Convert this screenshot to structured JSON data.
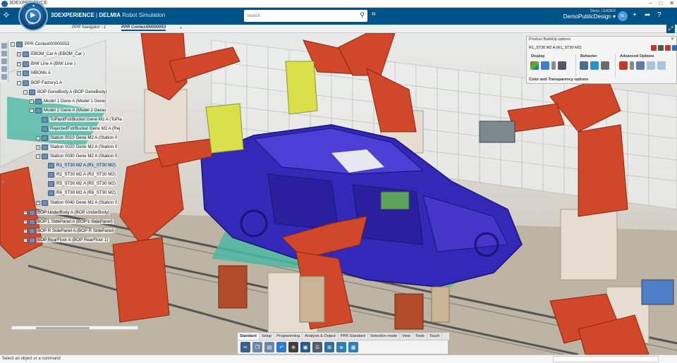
{
  "window": {
    "title": "3DEXPERIENCE",
    "controls": [
      "–",
      "□",
      "✕"
    ]
  },
  "header": {
    "brand_bold": "3DEXPERIENCE",
    "brand_sep": " | ",
    "brand_product": "DELMIA",
    "brand_app": "Robot Simulation",
    "compass_version": "V.R",
    "search_placeholder": "Search",
    "user_name": "Demo, LEADER",
    "tenant": "DemoPublicDesign ▾",
    "avatar_initials": "DL",
    "accent": "#005386"
  },
  "tabs": [
    {
      "label": "PPR Navigator - 1",
      "active": false
    },
    {
      "label": "PPR Context00000053",
      "active": true
    }
  ],
  "tree": {
    "nodes": [
      {
        "label": "PPR Context00000053",
        "level": 0,
        "toggle": "−"
      },
      {
        "label": "EBOM_Car A (EBOM_Car )",
        "level": 1,
        "toggle": "+"
      },
      {
        "label": "BIW Line A (BIW Line )",
        "level": 1,
        "toggle": "+"
      },
      {
        "label": "MBOMs A",
        "level": 1,
        "toggle": "+"
      },
      {
        "label": "BOP Factory1 A",
        "level": 1,
        "toggle": "−"
      },
      {
        "label": "BOP GeneBody A (BOP GeneBody)",
        "level": 2,
        "toggle": "−"
      },
      {
        "label": "Model 1 Gene A (Model 1 Gene)",
        "level": 3,
        "toggle": "+"
      },
      {
        "label": "Model 2 Gene A (Model 2 Gene)",
        "level": 3,
        "toggle": "−"
      },
      {
        "label": "ToPlantFstrBucket Gene M2 A (ToPla",
        "level": 4,
        "toggle": ""
      },
      {
        "label": "RejectedFstrBucket Gene M2 A (Rej",
        "level": 4,
        "toggle": ""
      },
      {
        "label": "Station 0010 Gene M2 A (Station 0",
        "level": 4,
        "toggle": "+"
      },
      {
        "label": "Station 0020 Gene M2 A (Station 0",
        "level": 4,
        "toggle": "+"
      },
      {
        "label": "Station 0030 Gene M2 A (Station 0",
        "level": 4,
        "toggle": "−"
      },
      {
        "label": "R1_ST30 M2 A (R1_ST30 M2)",
        "level": 5,
        "toggle": "",
        "selected": true
      },
      {
        "label": "R2_ST30 M2 A (R2_ST30 M2)",
        "level": 5,
        "toggle": ""
      },
      {
        "label": "R5_ST30 M2 A (R5_ST30 M2)",
        "level": 5,
        "toggle": ""
      },
      {
        "label": "R6_ST30 M2 A (R6_ST30 M2)",
        "level": 5,
        "toggle": ""
      },
      {
        "label": "Station 0040 Gene M2 A (Station 0",
        "level": 4,
        "toggle": "+"
      },
      {
        "label": "BOP UnderBody A (BOP UnderBody)",
        "level": 2,
        "toggle": "+"
      },
      {
        "label": "BOP L SidePanel A (BOP L SidePanel)",
        "level": 2,
        "toggle": "+"
      },
      {
        "label": "BOP R SidePanel A (BOP R SidePanel)",
        "level": 2,
        "toggle": "+"
      },
      {
        "label": "BOP RearFloor A (BOP RearFloor 1)",
        "level": 2,
        "toggle": "+"
      }
    ]
  },
  "options_panel": {
    "title": "Product BuildUp options",
    "close": "✕",
    "target": "R1_ST30 M2 A (R1_ST30 M2)",
    "group_display": "Display",
    "group_behavior": "Behavior",
    "group_advanced": "Advanced Options",
    "section": "Color and Transparency options"
  },
  "action_bar": {
    "tabs": [
      "Standard",
      "Setup",
      "Programming",
      "Analysis & Output",
      "PPR Standard",
      "Selection mode",
      "View",
      "Tools",
      "Touch"
    ],
    "active_tab": "Standard"
  },
  "status": {
    "message": "Select an object or a command"
  }
}
